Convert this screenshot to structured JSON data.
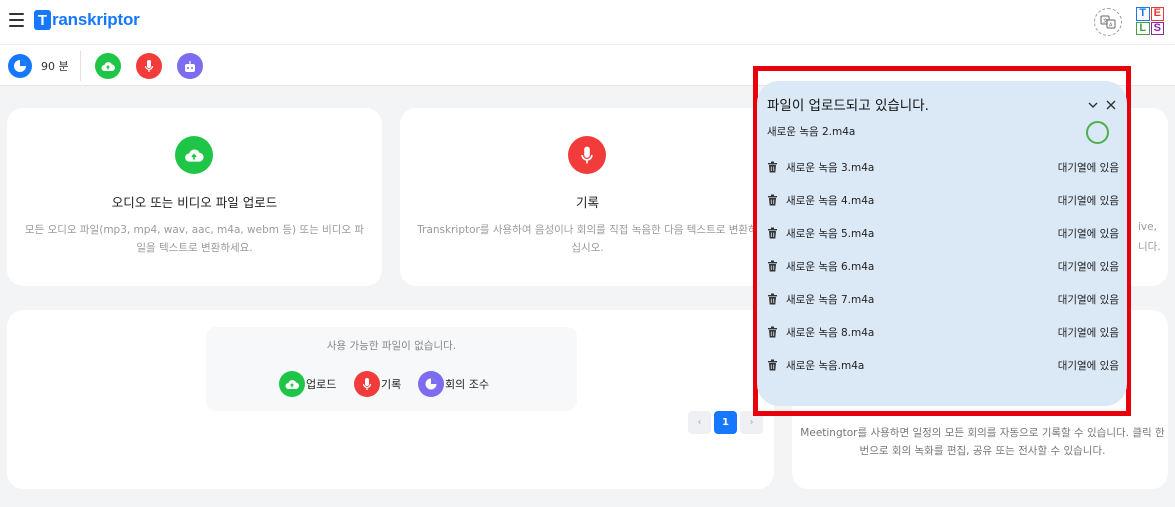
{
  "header": {
    "logo_letter": "T",
    "logo_text": "ranskriptor",
    "lang_icon": "translate-icon",
    "tels_letters": [
      "T",
      "E",
      "L",
      "S"
    ],
    "tels_colors": [
      "#1677ff",
      "#e53935",
      "#43a047",
      "#8e24aa"
    ]
  },
  "toolbar": {
    "minutes": "90 분",
    "upload_icon": "cloud-upload-icon",
    "record_icon": "microphone-icon",
    "bot_icon": "robot-icon"
  },
  "cards": {
    "upload": {
      "title": "오디오 또는 비디오 파일 업로드",
      "desc": "모든 오디오 파일(mp3, mp4, wav, aac, m4a, webm 등) 또는 비디오 파일을 텍스트로 변환하세요."
    },
    "record": {
      "title": "기록",
      "desc": "Transkriptor를 사용하여 음성이나 회의를 직접 녹음한 다음 텍스트로 변환하십시오."
    },
    "right_partial": {
      "line1": "ive,",
      "line2": "니다."
    }
  },
  "files": {
    "empty_text": "사용 가능한 파일이 없습니다.",
    "chip_upload": "업로드",
    "chip_record": "기록",
    "chip_meeting": "회의 조수"
  },
  "pagination": {
    "prev": "‹",
    "current": "1",
    "next": "›"
  },
  "meetingtor": {
    "desc": "Meetingtor를 사용하면 일정의 모든 회의를 자동으로 기록할 수 있습니다. 클릭 한 번으로 회의 녹화를 편집, 공유 또는 전사할 수 있습니다."
  },
  "upload_panel": {
    "title": "파일이 업로드되고 있습니다.",
    "uploading_file": "새로운 녹음 2.m4a",
    "queued": [
      {
        "name": "새로운 녹음 3.m4a",
        "status": "대기열에 있음"
      },
      {
        "name": "새로운 녹음 4.m4a",
        "status": "대기열에 있음"
      },
      {
        "name": "새로운 녹음 5.m4a",
        "status": "대기열에 있음"
      },
      {
        "name": "새로운 녹음 6.m4a",
        "status": "대기열에 있음"
      },
      {
        "name": "새로운 녹음 7.m4a",
        "status": "대기열에 있음"
      },
      {
        "name": "새로운 녹음 8.m4a",
        "status": "대기열에 있음"
      },
      {
        "name": "새로운 녹음.m4a",
        "status": "대기열에 있음"
      }
    ]
  },
  "colors": {
    "brand": "#1677ff",
    "upload_green": "#1ec546",
    "record_red": "#f23c3c",
    "bot_purple": "#7c6cf0",
    "panel_bg": "#dbe8f6",
    "highlight": "#e8000b"
  }
}
